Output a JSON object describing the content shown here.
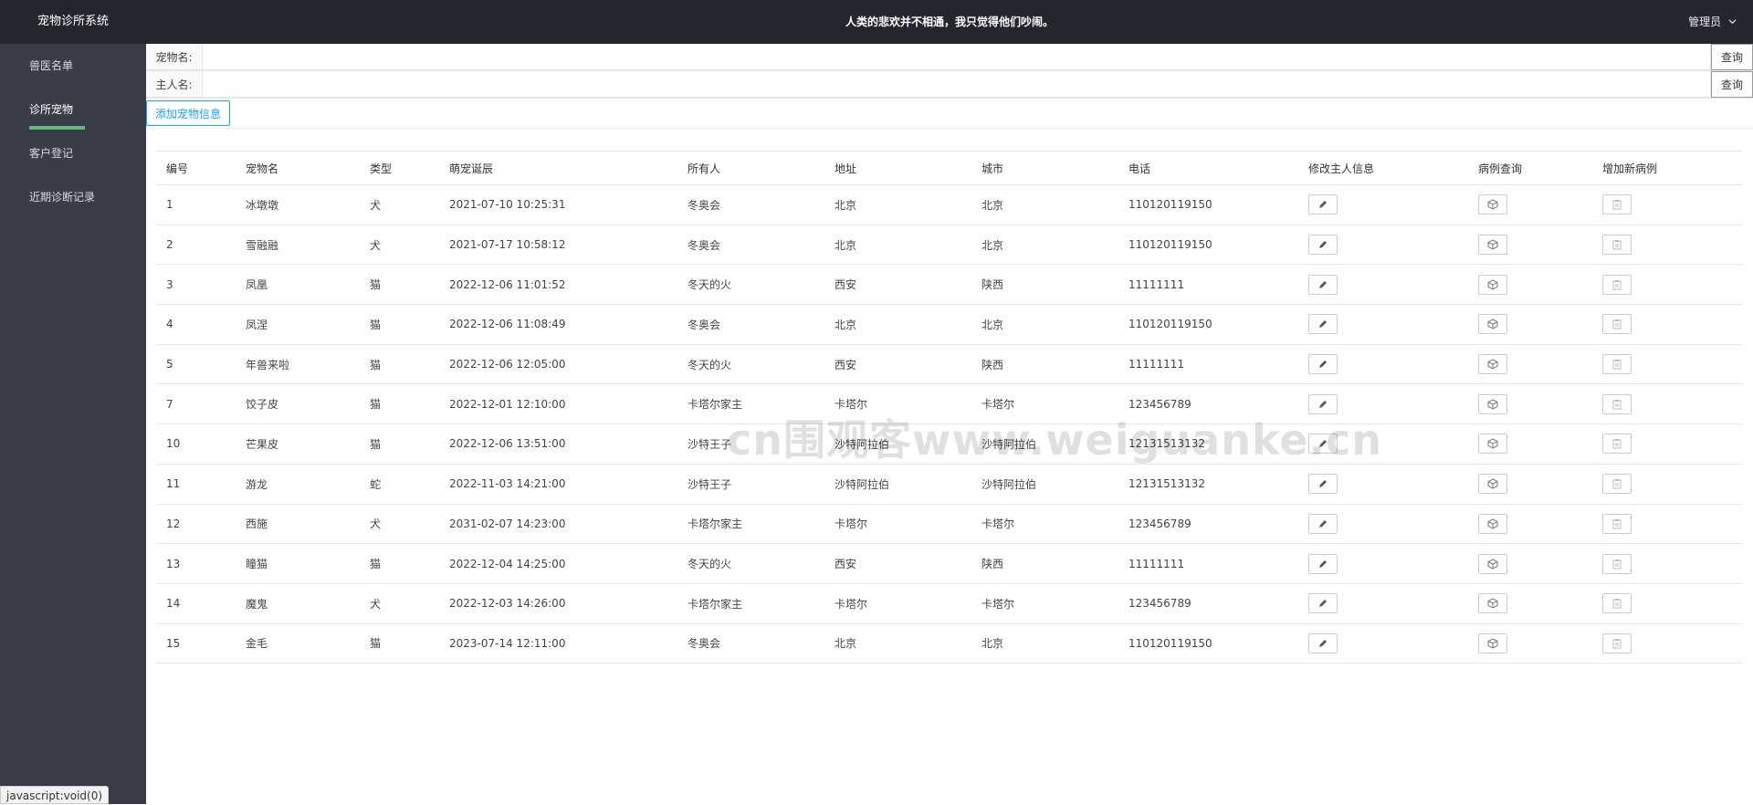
{
  "app": {
    "title": "宠物诊所系统",
    "header_message": "人类的悲欢并不相通，我只觉得他们吵闹。",
    "user_label": "管理员"
  },
  "sidebar": {
    "items": [
      {
        "label": "兽医名单"
      },
      {
        "label": "诊所宠物"
      },
      {
        "label": "客户登记"
      },
      {
        "label": "近期诊断记录"
      }
    ]
  },
  "search": {
    "pet_label": "宠物名:",
    "owner_label": "主人名:",
    "query_label": "查询",
    "pet_value": "",
    "owner_value": ""
  },
  "add_button_label": "添加宠物信息",
  "table": {
    "headers": [
      "编号",
      "宠物名",
      "类型",
      "萌宠诞辰",
      "所有人",
      "地址",
      "城市",
      "电话",
      "修改主人信息",
      "病例查询",
      "增加新病例"
    ],
    "rows": [
      [
        "1",
        "冰墩墩",
        "犬",
        "2021-07-10 10:25:31",
        "冬奥会",
        "北京",
        "北京",
        "110120119150"
      ],
      [
        "2",
        "雪融融",
        "犬",
        "2021-07-17 10:58:12",
        "冬奥会",
        "北京",
        "北京",
        "110120119150"
      ],
      [
        "3",
        "凤凰",
        "猫",
        "2022-12-06 11:01:52",
        "冬天的火",
        "西安",
        "陕西",
        "11111111"
      ],
      [
        "4",
        "凤涅",
        "猫",
        "2022-12-06 11:08:49",
        "冬奥会",
        "北京",
        "北京",
        "110120119150"
      ],
      [
        "5",
        "年兽来啦",
        "猫",
        "2022-12-06 12:05:00",
        "冬天的火",
        "西安",
        "陕西",
        "11111111"
      ],
      [
        "7",
        "饺子皮",
        "猫",
        "2022-12-01 12:10:00",
        "卡塔尔家主",
        "卡塔尔",
        "卡塔尔",
        "123456789"
      ],
      [
        "10",
        "芒果皮",
        "猫",
        "2022-12-06 13:51:00",
        "沙特王子",
        "沙特阿拉伯",
        "沙特阿拉伯",
        "12131513132"
      ],
      [
        "11",
        "游龙",
        "蛇",
        "2022-11-03 14:21:00",
        "沙特王子",
        "沙特阿拉伯",
        "沙特阿拉伯",
        "12131513132"
      ],
      [
        "12",
        "西施",
        "犬",
        "2031-02-07 14:23:00",
        "卡塔尔家主",
        "卡塔尔",
        "卡塔尔",
        "123456789"
      ],
      [
        "13",
        "瞳猫",
        "猫",
        "2022-12-04 14:25:00",
        "冬天的火",
        "西安",
        "陕西",
        "11111111"
      ],
      [
        "14",
        "魔鬼",
        "犬",
        "2022-12-03 14:26:00",
        "卡塔尔家主",
        "卡塔尔",
        "卡塔尔",
        "123456789"
      ],
      [
        "15",
        "金毛",
        "猫",
        "2023-07-14 12:11:00",
        "冬奥会",
        "北京",
        "北京",
        "110120119150"
      ]
    ]
  },
  "icons": {
    "edit": "pencil-icon",
    "case_query": "box-icon",
    "add_case": "clipboard-icon"
  },
  "colors": {
    "sidebar_bg": "#393d49",
    "header_bg": "#23262e",
    "active_indicator": "#5FB878",
    "accent_blue": "#1E9FFF"
  },
  "watermark": "cn围观客www.weiguanke.cn",
  "status_text": "javascript:void(0)"
}
